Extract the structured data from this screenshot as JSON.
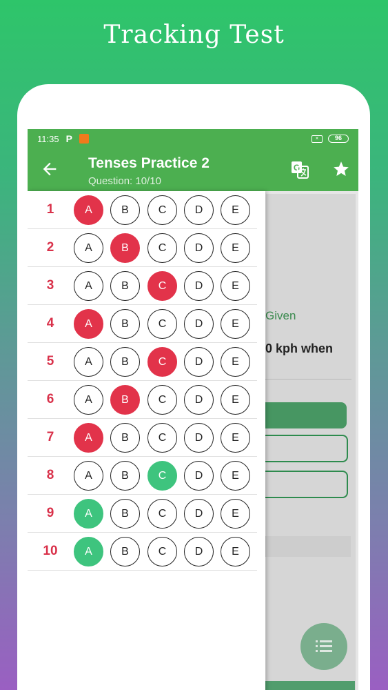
{
  "promo": {
    "title": "Tracking Test"
  },
  "status_bar": {
    "time": "11:35",
    "p_label": "P",
    "battery": "96"
  },
  "app_bar": {
    "title": "Tenses Practice 2",
    "subtitle": "Question: 10/10"
  },
  "background_screen": {
    "given_text": "Given",
    "question_fragment": "0 kph when"
  },
  "colors": {
    "accent": "#4caf50",
    "wrong": "#e2334a",
    "correct": "#3ec47e",
    "number": "#d9314a"
  },
  "tracker": {
    "options": [
      "A",
      "B",
      "C",
      "D",
      "E"
    ],
    "rows": [
      {
        "num": "1",
        "selected": "A",
        "state": "wrong"
      },
      {
        "num": "2",
        "selected": "B",
        "state": "wrong"
      },
      {
        "num": "3",
        "selected": "C",
        "state": "wrong"
      },
      {
        "num": "4",
        "selected": "A",
        "state": "wrong"
      },
      {
        "num": "5",
        "selected": "C",
        "state": "wrong"
      },
      {
        "num": "6",
        "selected": "B",
        "state": "wrong"
      },
      {
        "num": "7",
        "selected": "A",
        "state": "wrong"
      },
      {
        "num": "8",
        "selected": "C",
        "state": "correct"
      },
      {
        "num": "9",
        "selected": "A",
        "state": "correct"
      },
      {
        "num": "10",
        "selected": "A",
        "state": "correct"
      }
    ]
  },
  "icons": {
    "back": "arrow-back-icon",
    "translate": "translate-icon",
    "star": "star-icon",
    "fab": "list-icon"
  }
}
